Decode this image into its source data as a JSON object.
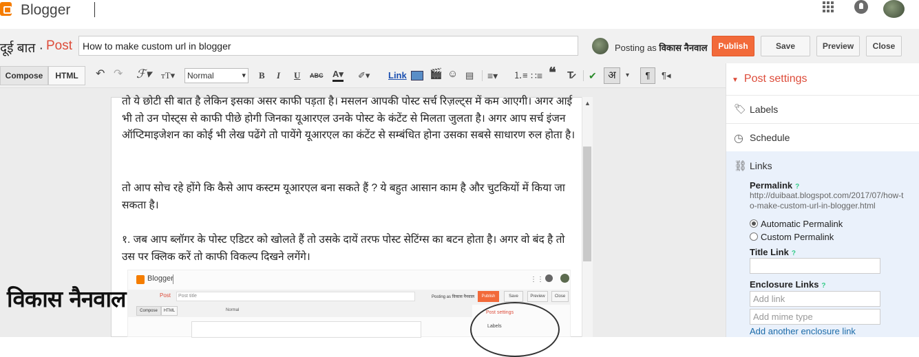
{
  "header": {
    "brand": "Blogger",
    "apps_icon": "apps-grid-icon",
    "notifications_icon": "bell-icon"
  },
  "titlebar": {
    "blog_name": "दूई बात ·",
    "post_label": "Post",
    "post_title": "How to make custom url in blogger",
    "posting_as": "Posting as",
    "author": "विकास नैनवाल",
    "publish": "Publish",
    "save": "Save",
    "preview": "Preview",
    "close": "Close"
  },
  "toolbar": {
    "compose": "Compose",
    "html": "HTML",
    "format": "Normal",
    "bold": "B",
    "italic": "I",
    "underline": "U",
    "strike": "ABC",
    "link": "Link",
    "hindi": "अ"
  },
  "editor": {
    "p1": "तो ये छोटी सी बात है लेकिन इसका असर काफी पड़ता है। मसलन आपकी पोस्ट सर्च रिज़ल्ट्स में कम आएगी। अगर आई भी तो उन पोस्ट्स से काफी पीछे होगी जिनका यूआरएल उनके पोस्ट के कंटेंट से मिलता जुलता है। अगर आप सर्च इंजन ऑप्टिमाइजेशन का कोई भी लेख पढेंगे तो पायेंगे यूआरएल का कंटेंट से सम्बंधित होना उसका सबसे साधारण रुल होता है।",
    "p2": "तो आप सोच रहे होंगे कि कैसे आप कस्टम यूआरएल बना सकते हैं ? ये बहुत आसान काम है और चुटकियों में किया जा सकता है।",
    "p3": "१. जब आप ब्लॉगर के पोस्ट एडिटर को खोलते हैं तो उसके दायें तरफ पोस्ट सेटिंग्स का बटन होता है। अगर वो बंद है तो उस पर क्लिक करें तो काफी विकल्प दिखने लगेंगे।"
  },
  "embedded_screenshot": {
    "brand": "Blogger",
    "post_label": "Post",
    "title_placeholder": "Post title",
    "posting_as": "Posting as विकास नैनवाल",
    "publish": "Publish",
    "save": "Save",
    "preview": "Preview",
    "close": "Close",
    "compose": "Compose",
    "html": "HTML",
    "format": "Normal",
    "post_settings": "Post settings",
    "labels": "Labels"
  },
  "watermark": "विकास नैनवाल",
  "sidebar": {
    "post_settings": "Post settings",
    "labels": "Labels",
    "schedule": "Schedule",
    "links": "Links",
    "permalink_label": "Permalink",
    "permalink_url": "http://duibaat.blogspot.com/2017/07/how-to-make-custom-url-in-blogger.html",
    "automatic_permalink": "Automatic Permalink",
    "custom_permalink": "Custom Permalink",
    "title_link": "Title Link",
    "enclosure_links": "Enclosure Links",
    "add_link_placeholder": "Add link",
    "add_mime_placeholder": "Add mime type",
    "add_another": "Add another enclosure link",
    "help": "?"
  }
}
